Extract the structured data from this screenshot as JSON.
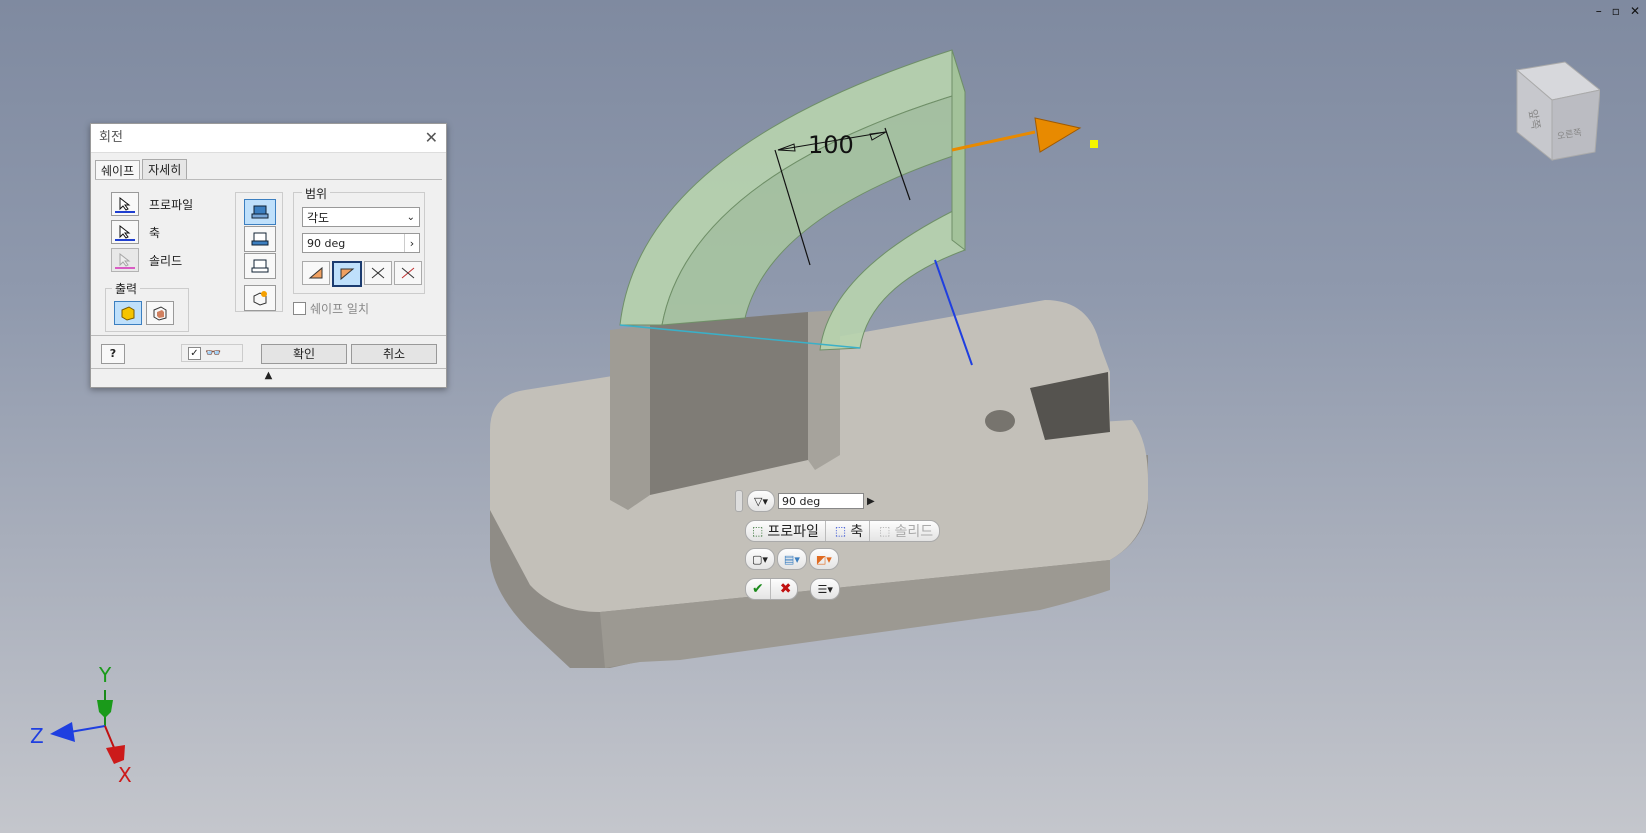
{
  "window_controls": {
    "minimize": "–",
    "restore": "▫",
    "close": "✕"
  },
  "dialog": {
    "title": "회전",
    "tabs": [
      "쉐이프",
      "자세히"
    ],
    "selectors": [
      {
        "label": "프로파일",
        "underline": "#1f3fd0"
      },
      {
        "label": "축",
        "underline": "#1f3fd0"
      },
      {
        "label": "솔리드",
        "underline": "#d01fb0"
      }
    ],
    "output_label": "출력",
    "extent_label": "범위",
    "extent_type": "각도",
    "angle_value": "90 deg",
    "match_shape_label": "쉐이프 일치",
    "ok_label": "확인",
    "cancel_label": "취소",
    "help_label": "?",
    "collapse_glyph": "▲"
  },
  "viewport": {
    "dimension_value": "100",
    "axis_x": "X",
    "axis_y": "Y",
    "axis_z": "Z",
    "viewcube_front": "앞쪽",
    "viewcube_right": "오른쪽"
  },
  "mini_toolbar": {
    "angle_value": "90 deg",
    "profile_label": "프로파일",
    "axis_label": "축",
    "solid_label": "솔리드"
  },
  "colors": {
    "accent_blue": "#3c7fc0",
    "profile_green": "#b8d4ae",
    "body_gray": "#bdbab3",
    "arrow_orange": "#e88a00"
  }
}
